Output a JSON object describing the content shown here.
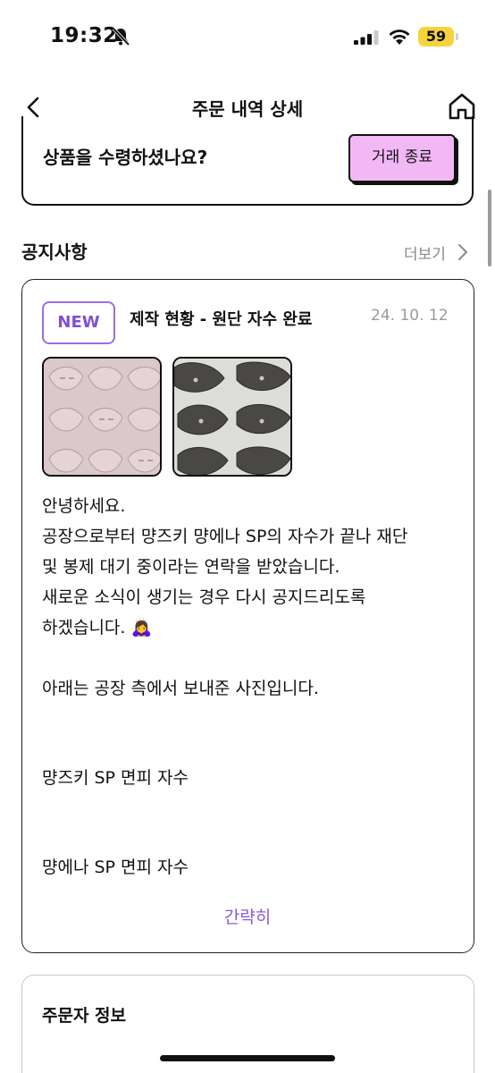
{
  "status_bar": {
    "time": "19:32",
    "battery": "59"
  },
  "nav": {
    "title": "주문 내역 상세"
  },
  "receipt": {
    "question": "상품을 수령하셨나요?",
    "end_trade_label": "거래 종료"
  },
  "notices": {
    "section_title": "공지사항",
    "more_label": "더보기",
    "item": {
      "badge": "NEW",
      "title": "제작 현황 - 원단 자수 완료",
      "date": "24. 10. 12",
      "body": [
        "안녕하세요.",
        "공장으로부터 먕즈키 먕에나 SP의 자수가 끝나 재단",
        "및 봉제 대기 중이라는 연락을 받았습니다.",
        "새로운 소식이 생기는 경우 다시 공지드리도록",
        "하겠습니다. 🙇‍♀️",
        "아래는 공장 측에서 보내준 사진입니다.",
        "먕즈키 SP 면피 자수",
        "먕에나 SP 면피 자수"
      ],
      "collapse_label": "간략히"
    }
  },
  "orderer": {
    "title": "주문자 정보"
  },
  "colors": {
    "accent_purple": "#7f4fd4",
    "button_pink": "#f2b8f6",
    "battery_yellow": "#f5d33d"
  }
}
